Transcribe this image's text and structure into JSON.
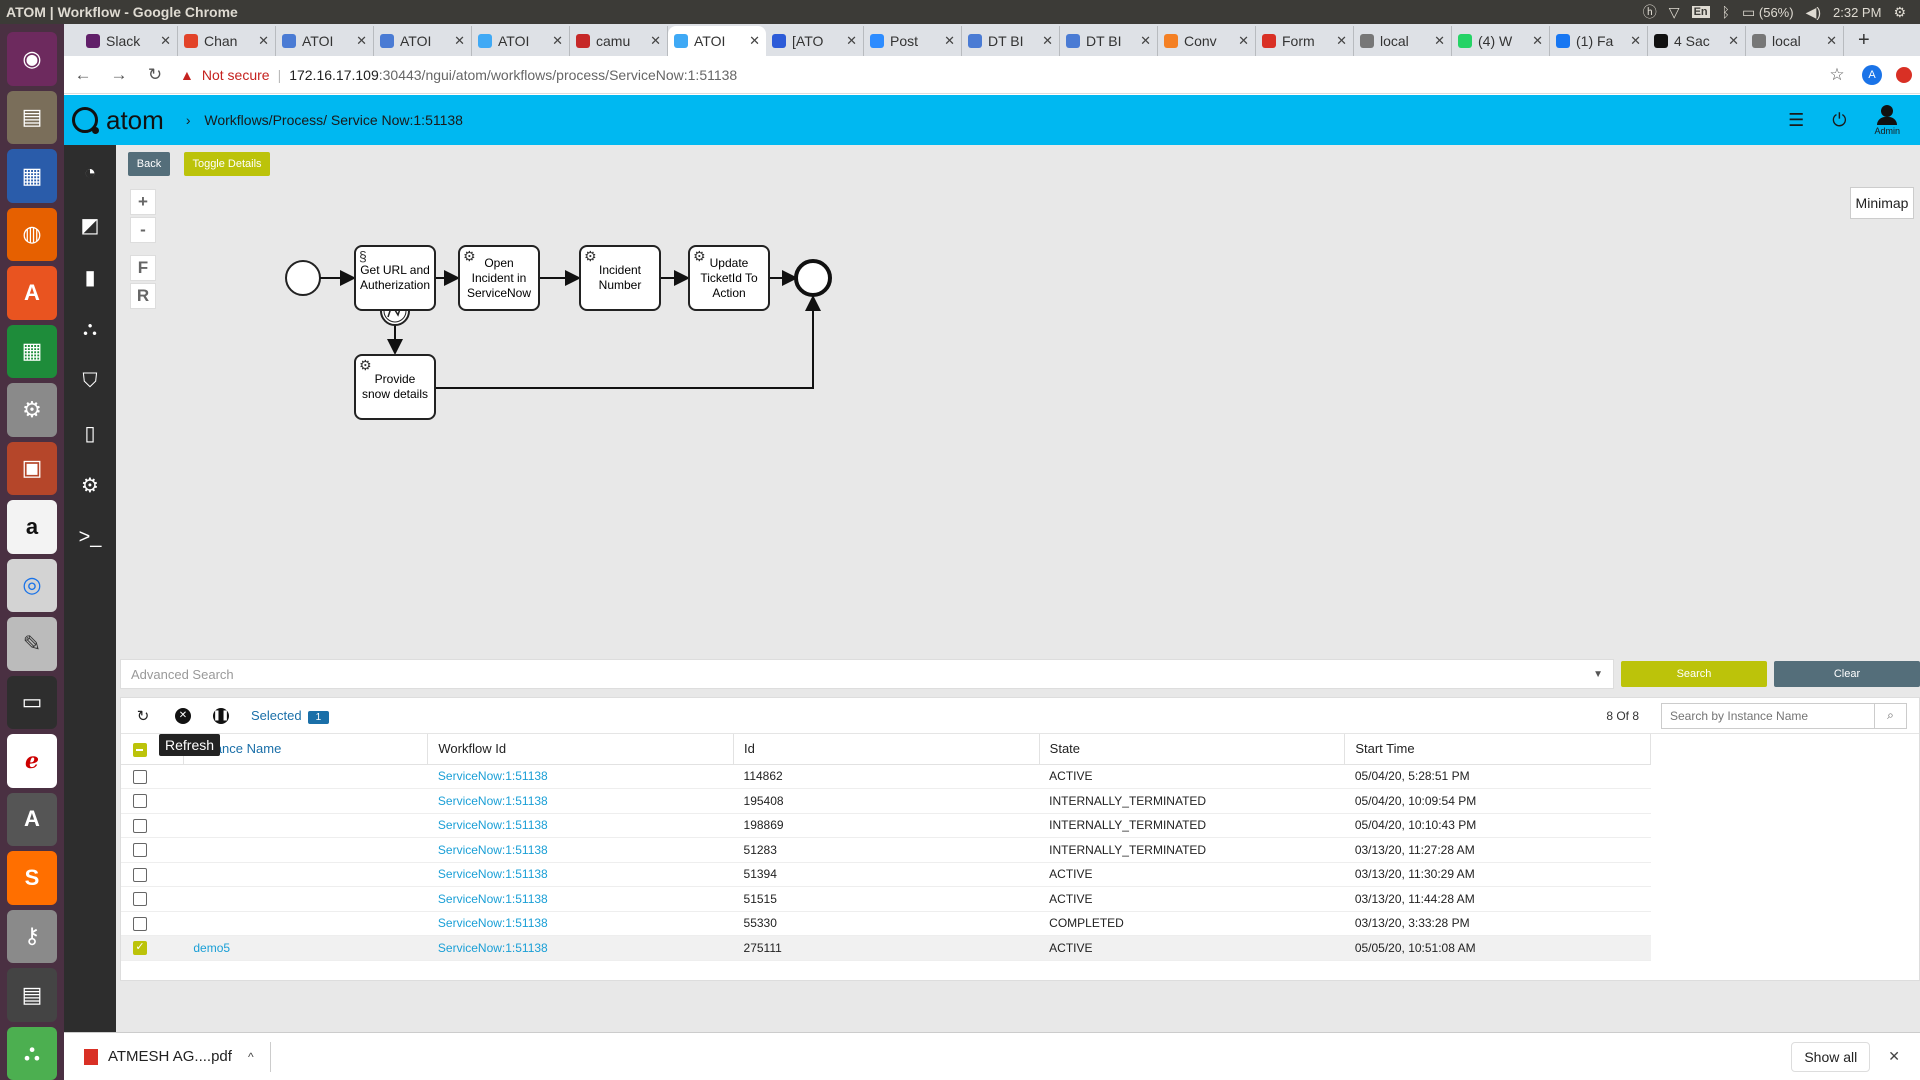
{
  "window": {
    "title": "ATOM | Workflow - Google Chrome"
  },
  "tray": {
    "lang": "En",
    "battery": "(56%)",
    "time": "2:32 PM"
  },
  "tabs": [
    {
      "label": "Slack",
      "color": "#611f69"
    },
    {
      "label": "Chan",
      "color": "#e24329"
    },
    {
      "label": "ATOI",
      "color": "#4a7bd4"
    },
    {
      "label": "ATOI",
      "color": "#4a7bd4"
    },
    {
      "label": "ATOI",
      "color": "#3fa9f5"
    },
    {
      "label": "camu",
      "color": "#c62828"
    },
    {
      "label": "ATOI",
      "color": "#3fa9f5"
    },
    {
      "label": "[ATO",
      "color": "#2c5bd8"
    },
    {
      "label": "Post",
      "color": "#2d8cff"
    },
    {
      "label": "DT BI",
      "color": "#4a7bd4"
    },
    {
      "label": "DT BI",
      "color": "#4a7bd4"
    },
    {
      "label": "Conv",
      "color": "#f48024"
    },
    {
      "label": "Form",
      "color": "#d93025"
    },
    {
      "label": "local",
      "color": "#777777"
    },
    {
      "label": "(4) W",
      "color": "#25d366"
    },
    {
      "label": "(1) Fa",
      "color": "#1877f2"
    },
    {
      "label": "4 Sac",
      "color": "#111111"
    },
    {
      "label": "local",
      "color": "#777777"
    }
  ],
  "address": {
    "not_secure": "Not secure",
    "host": "172.16.17.109",
    "path": ":30443/ngui/atom/workflows/process/ServiceNow:1:51138"
  },
  "header": {
    "logo": "atom",
    "breadcrumb": "Workflows/Process/ Service Now:1:51138",
    "admin_label": "Admin"
  },
  "actions": {
    "back": "Back",
    "toggle": "Toggle Details",
    "minimap": "Minimap"
  },
  "zoom": {
    "plus": "+",
    "minus": "-",
    "f": "F",
    "r": "R"
  },
  "diagram": {
    "tasks": [
      {
        "id": "t1",
        "label": "Get URL and Autherization"
      },
      {
        "id": "t2",
        "label": "Open Incident in ServiceNow"
      },
      {
        "id": "t3",
        "label": "Incident Number"
      },
      {
        "id": "t4",
        "label": "Update TicketId To Action"
      },
      {
        "id": "t5",
        "label": "Provide snow details"
      }
    ]
  },
  "search": {
    "placeholder": "Advanced Search",
    "search_btn": "Search",
    "clear_btn": "Clear"
  },
  "table_toolbar": {
    "selected_label": "Selected",
    "selected_count": "1",
    "count": "8 Of 8",
    "search_placeholder": "Search by Instance Name",
    "tooltip": "Refresh"
  },
  "table": {
    "columns": [
      "Instance Name",
      "Workflow Id",
      "Id",
      "State",
      "Start Time"
    ],
    "rows": [
      {
        "instance": "",
        "workflow": "ServiceNow:1:51138",
        "id": "114862",
        "state": "ACTIVE",
        "start": "05/04/20, 5:28:51 PM",
        "checked": false
      },
      {
        "instance": "",
        "workflow": "ServiceNow:1:51138",
        "id": "195408",
        "state": "INTERNALLY_TERMINATED",
        "start": "05/04/20, 10:09:54 PM",
        "checked": false
      },
      {
        "instance": "",
        "workflow": "ServiceNow:1:51138",
        "id": "198869",
        "state": "INTERNALLY_TERMINATED",
        "start": "05/04/20, 10:10:43 PM",
        "checked": false
      },
      {
        "instance": "",
        "workflow": "ServiceNow:1:51138",
        "id": "51283",
        "state": "INTERNALLY_TERMINATED",
        "start": "03/13/20, 11:27:28 AM",
        "checked": false
      },
      {
        "instance": "",
        "workflow": "ServiceNow:1:51138",
        "id": "51394",
        "state": "ACTIVE",
        "start": "03/13/20, 11:30:29 AM",
        "checked": false
      },
      {
        "instance": "",
        "workflow": "ServiceNow:1:51138",
        "id": "51515",
        "state": "ACTIVE",
        "start": "03/13/20, 11:44:28 AM",
        "checked": false
      },
      {
        "instance": "",
        "workflow": "ServiceNow:1:51138",
        "id": "55330",
        "state": "COMPLETED",
        "start": "03/13/20, 3:33:28 PM",
        "checked": false
      },
      {
        "instance": "demo5",
        "workflow": "ServiceNow:1:51138",
        "id": "275111",
        "state": "ACTIVE",
        "start": "05/05/20, 10:51:08 AM",
        "checked": true
      }
    ]
  },
  "downloads": {
    "file": "ATMESH AG....pdf",
    "show_all": "Show all"
  }
}
